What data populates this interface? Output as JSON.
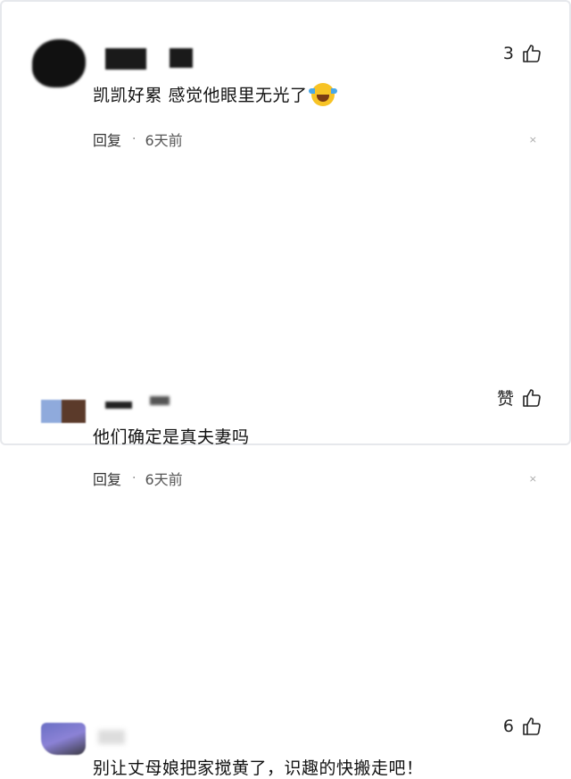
{
  "comments": [
    {
      "content": "凯凯好累 感觉他眼里无光了",
      "emoji": "laughing-crying-emoji",
      "reply_label": "回复",
      "separator": "·",
      "time": "6天前",
      "like_count": "3",
      "close_glyph": "×"
    },
    {
      "content": "他们确定是真夫妻吗",
      "reply_label": "回复",
      "separator": "·",
      "time": "6天前",
      "like_count": "赞",
      "close_glyph": "×"
    },
    {
      "content": "别让丈母娘把家搅黄了，识趣的快搬走吧！",
      "like_count": "6"
    }
  ],
  "icons": {
    "like": "thumbs-up-icon"
  }
}
